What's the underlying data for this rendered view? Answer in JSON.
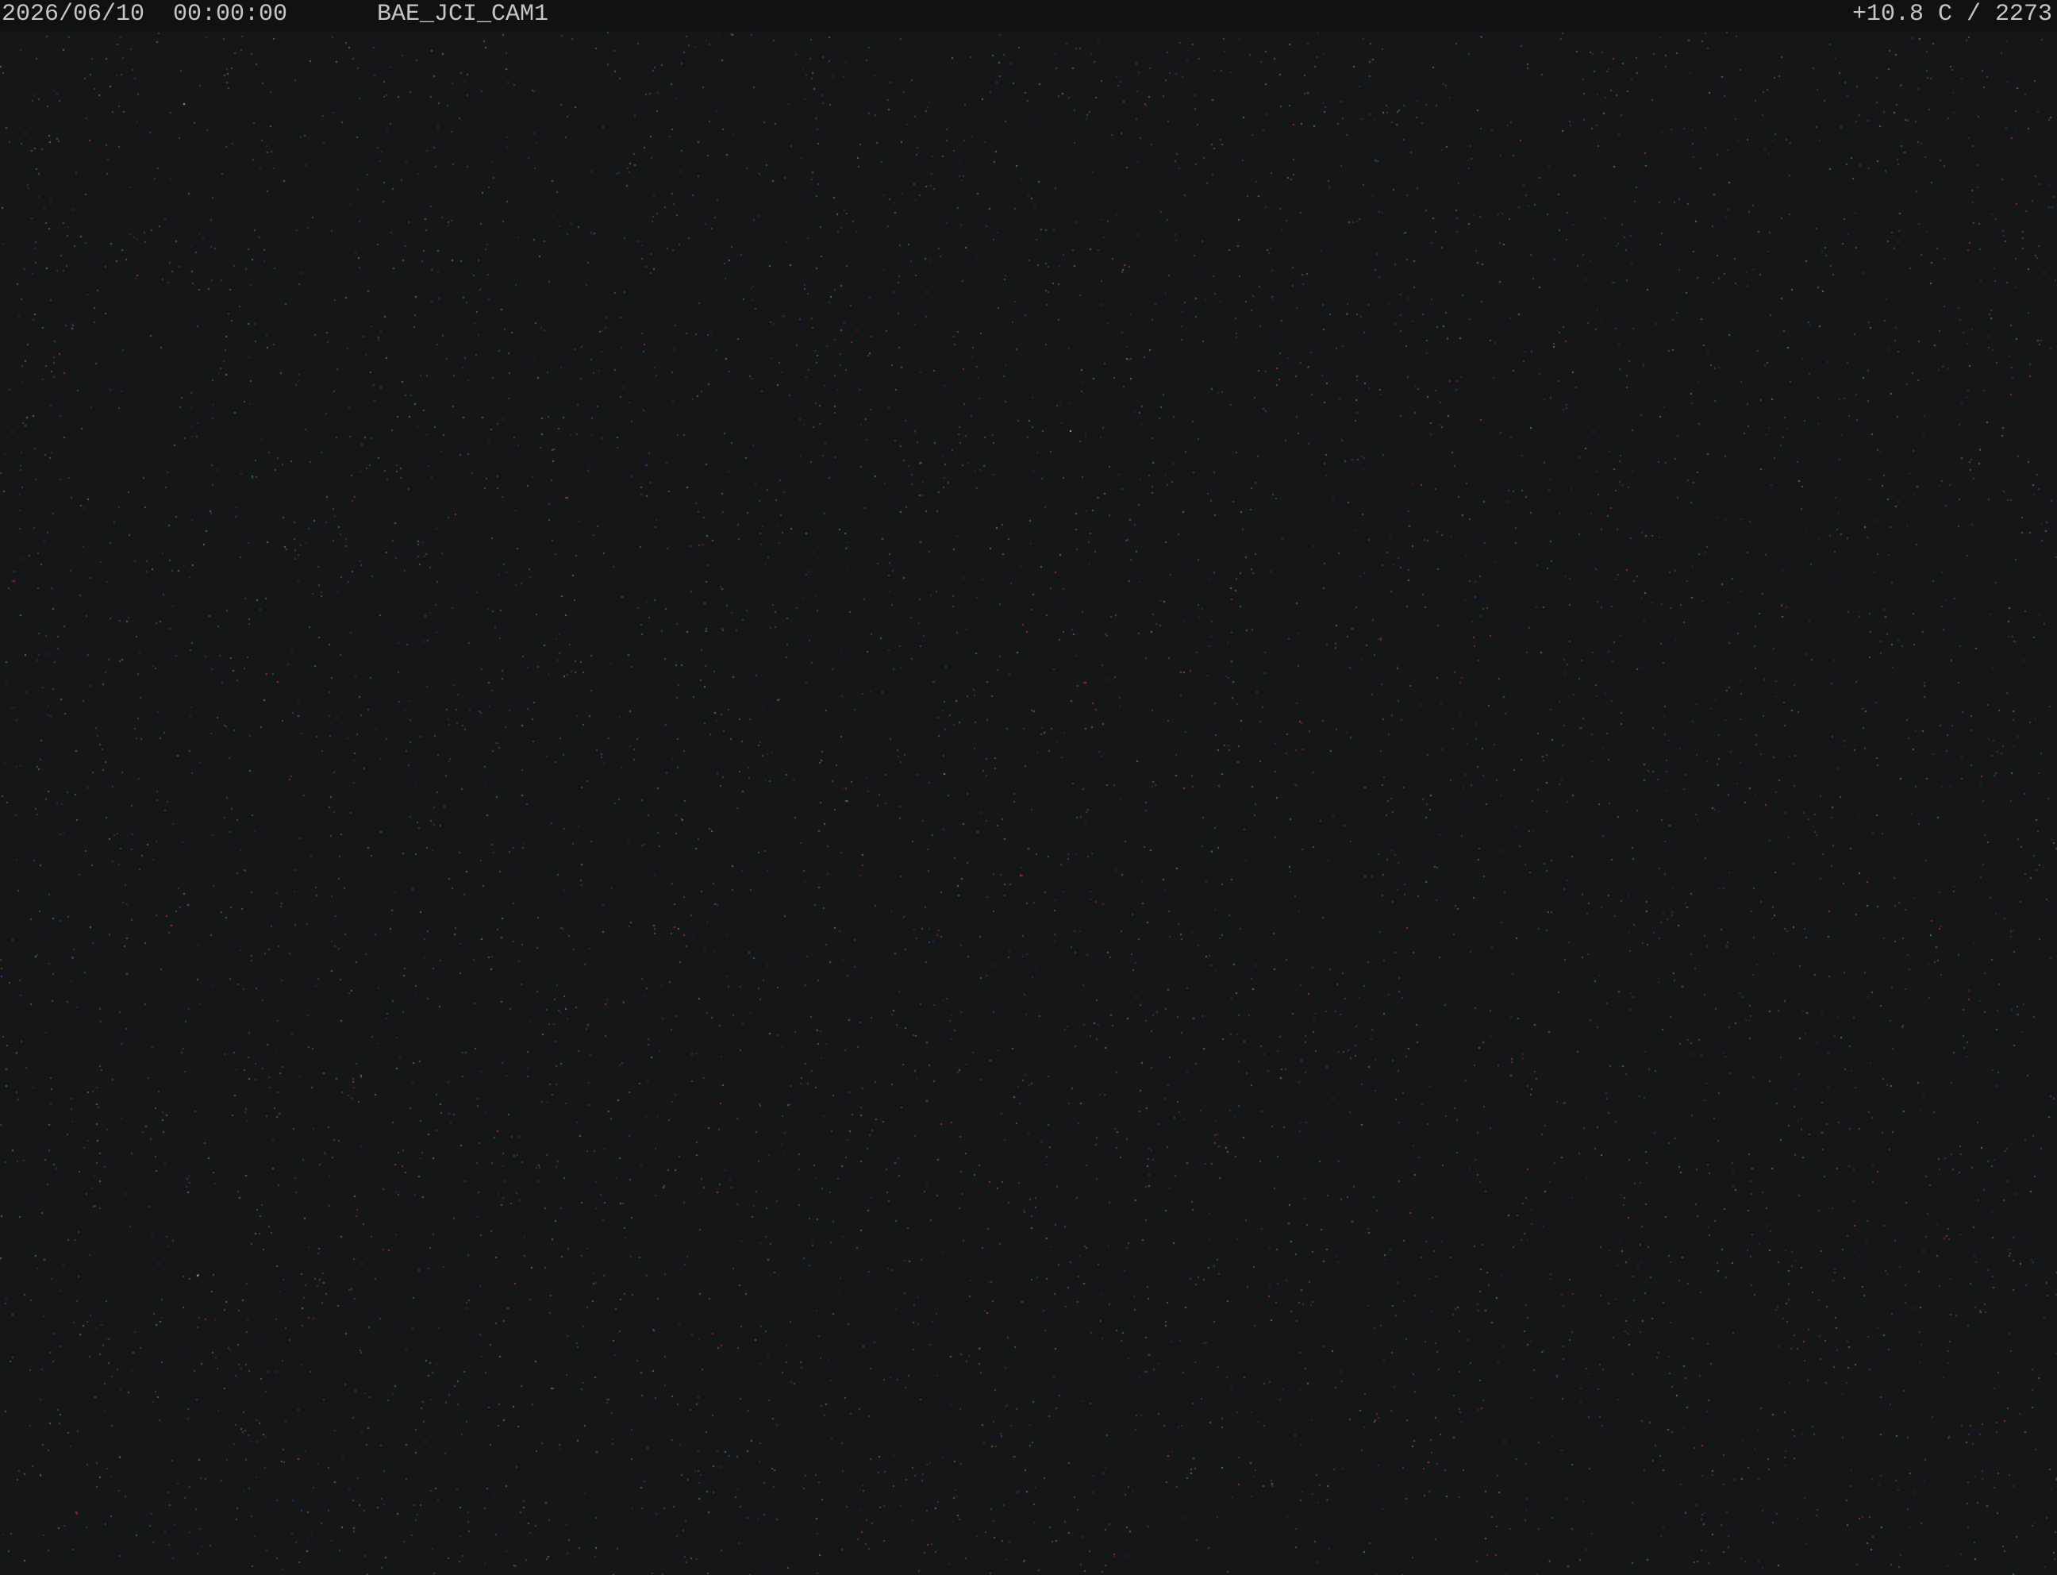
{
  "overlay": {
    "datetime": "2026/06/10  00:00:00",
    "camera_id": "BAE_JCI_CAM1",
    "temperature_status": "+10.8 C / 2273"
  },
  "image": {
    "background_color": "#151617",
    "overlay_bar_color": "#101112",
    "text_color": "#c6c6c6",
    "noise_colors": [
      "#b0303a",
      "#3a3fb0",
      "#3c8a3c",
      "#6a6a6a",
      "#c8c840"
    ]
  }
}
